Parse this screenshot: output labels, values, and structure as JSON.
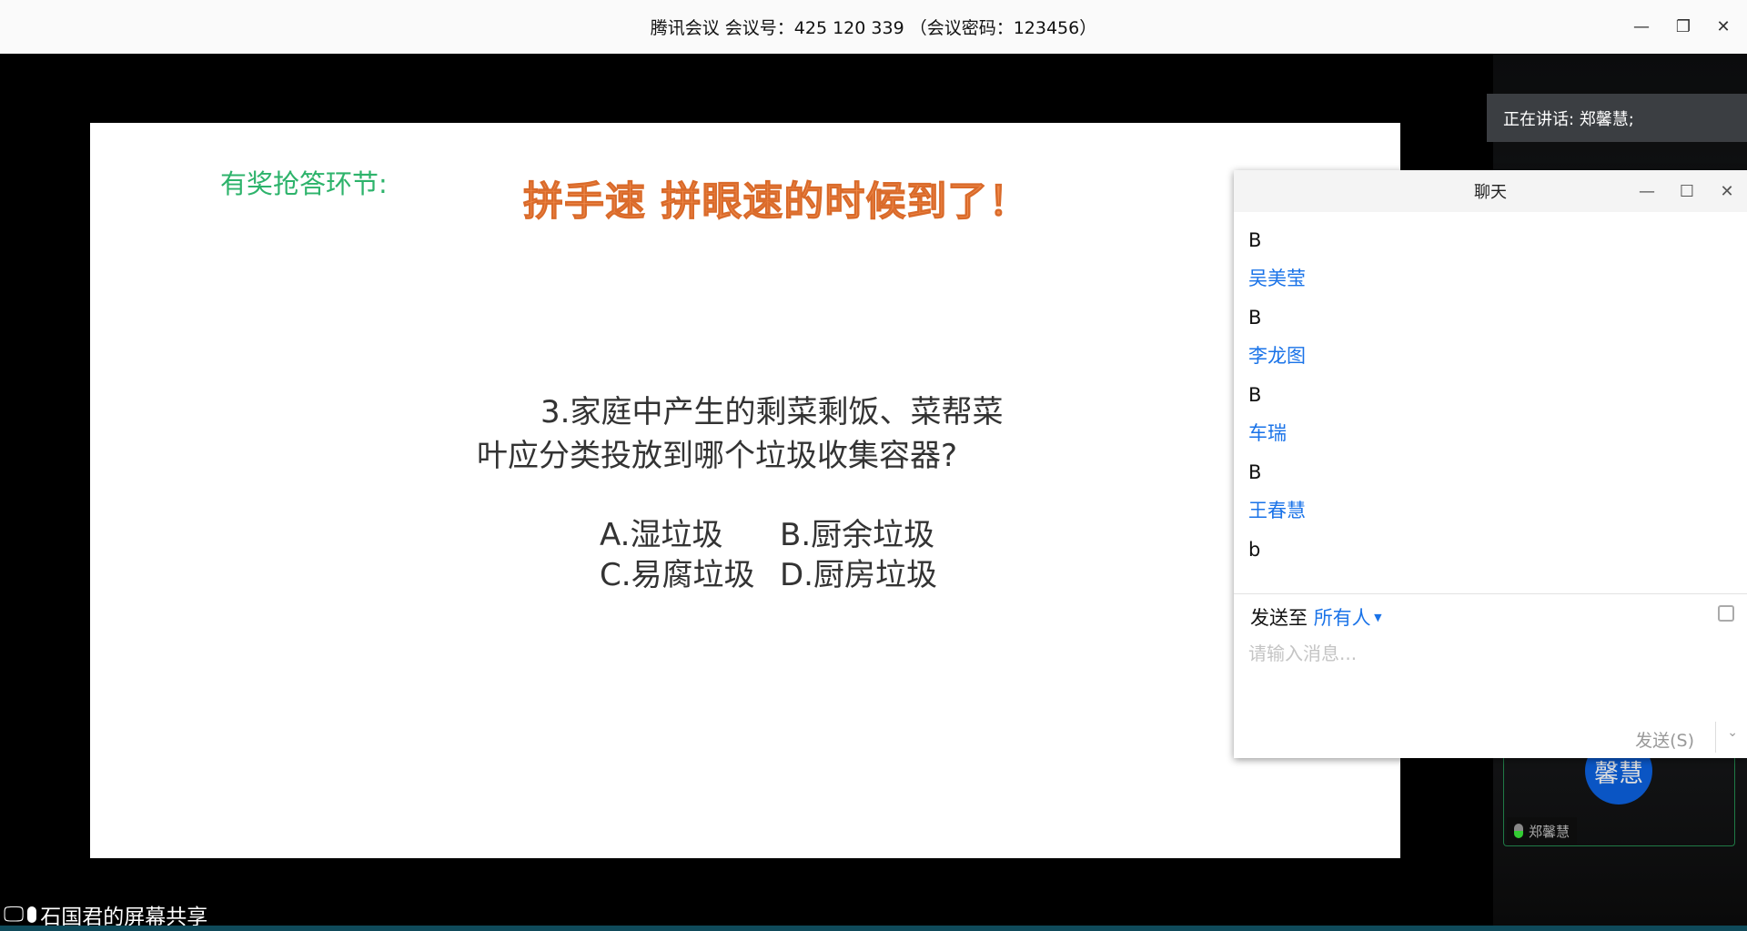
{
  "window": {
    "title": "腾讯会议 会议号：425 120 339 （会议密码：123456）",
    "minimize": "—",
    "restore": "❐",
    "close": "✕"
  },
  "slide": {
    "header": "有奖抢答环节:",
    "banner": "拼手速 拼眼速的时候到了！",
    "question_line1": "3.家庭中产生的剩菜剩饭、菜帮菜",
    "question_line2": "叶应分类投放到哪个垃圾收集容器?",
    "options": [
      "A.湿垃圾",
      "B.厨余垃圾",
      "C.易腐垃圾",
      "D.厨房垃圾"
    ]
  },
  "speaking": {
    "label": "正在讲话: 郑馨慧;"
  },
  "participant": {
    "avatar_text": "馨慧",
    "name": "郑馨慧"
  },
  "chat": {
    "title": "聊天",
    "minimize": "—",
    "maximize": "☐",
    "close": "✕",
    "messages": [
      {
        "text": "B",
        "sender": "吴美莹"
      },
      {
        "text": "B",
        "sender": "李龙图"
      },
      {
        "text": "B",
        "sender": "车瑞"
      },
      {
        "text": "B",
        "sender": "王春慧"
      },
      {
        "text": "b",
        "sender": ""
      }
    ],
    "send_to_label": "发送至",
    "send_to_value": "所有人",
    "placeholder": "请输入消息...",
    "send_button": "发送(S)"
  },
  "share": {
    "label": "石国君的屏幕共享"
  },
  "colors": {
    "accent": "#1a73e8",
    "green": "#2db36b",
    "orange": "#f08a4b"
  }
}
